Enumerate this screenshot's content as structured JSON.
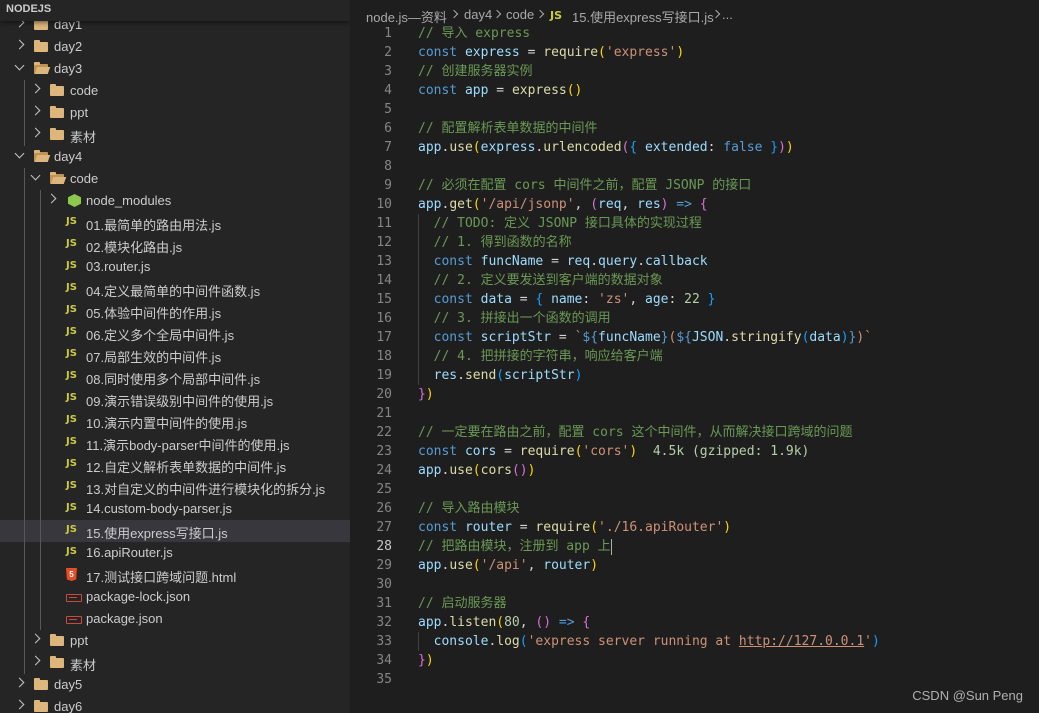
{
  "explorer": {
    "title": "NODEJS",
    "items": [
      {
        "label": "day1",
        "type": "folder",
        "depth": 0,
        "open": false
      },
      {
        "label": "day2",
        "type": "folder",
        "depth": 0,
        "open": false
      },
      {
        "label": "day3",
        "type": "folder",
        "depth": 0,
        "open": true
      },
      {
        "label": "code",
        "type": "folder",
        "depth": 1,
        "open": false
      },
      {
        "label": "ppt",
        "type": "folder",
        "depth": 1,
        "open": false
      },
      {
        "label": "素材",
        "type": "folder",
        "depth": 1,
        "open": false
      },
      {
        "label": "day4",
        "type": "folder",
        "depth": 0,
        "open": true
      },
      {
        "label": "code",
        "type": "folder",
        "depth": 1,
        "open": true
      },
      {
        "label": "node_modules",
        "type": "node",
        "depth": 2,
        "open": false
      },
      {
        "label": "01.最简单的路由用法.js",
        "type": "js",
        "depth": 2
      },
      {
        "label": "02.模块化路由.js",
        "type": "js",
        "depth": 2
      },
      {
        "label": "03.router.js",
        "type": "js",
        "depth": 2
      },
      {
        "label": "04.定义最简单的中间件函数.js",
        "type": "js",
        "depth": 2
      },
      {
        "label": "05.体验中间件的作用.js",
        "type": "js",
        "depth": 2
      },
      {
        "label": "06.定义多个全局中间件.js",
        "type": "js",
        "depth": 2
      },
      {
        "label": "07.局部生效的中间件.js",
        "type": "js",
        "depth": 2
      },
      {
        "label": "08.同时使用多个局部中间件.js",
        "type": "js",
        "depth": 2
      },
      {
        "label": "09.演示错误级别中间件的使用.js",
        "type": "js",
        "depth": 2
      },
      {
        "label": "10.演示内置中间件的使用.js",
        "type": "js",
        "depth": 2
      },
      {
        "label": "11.演示body-parser中间件的使用.js",
        "type": "js",
        "depth": 2
      },
      {
        "label": "12.自定义解析表单数据的中间件.js",
        "type": "js",
        "depth": 2
      },
      {
        "label": "13.对自定义的中间件进行模块化的拆分.js",
        "type": "js",
        "depth": 2
      },
      {
        "label": "14.custom-body-parser.js",
        "type": "js",
        "depth": 2
      },
      {
        "label": "15.使用express写接口.js",
        "type": "js",
        "depth": 2,
        "selected": true
      },
      {
        "label": "16.apiRouter.js",
        "type": "js",
        "depth": 2
      },
      {
        "label": "17.测试接口跨域问题.html",
        "type": "html",
        "depth": 2
      },
      {
        "label": "package-lock.json",
        "type": "json",
        "depth": 2
      },
      {
        "label": "package.json",
        "type": "json",
        "depth": 2
      },
      {
        "label": "ppt",
        "type": "folder",
        "depth": 1,
        "open": false
      },
      {
        "label": "素材",
        "type": "folder",
        "depth": 1,
        "open": false
      },
      {
        "label": "day5",
        "type": "folder",
        "depth": 0,
        "open": false
      },
      {
        "label": "day6",
        "type": "folder",
        "depth": 0,
        "open": false
      }
    ]
  },
  "breadcrumb": {
    "parts": [
      "node.js—资料",
      "day4",
      "code"
    ],
    "file_badge": "JS",
    "file": "15.使用express写接口.js",
    "more": "..."
  },
  "editor": {
    "current_line": 28,
    "lines": [
      {
        "n": 1,
        "t": [
          [
            "// 导入 express",
            "cm"
          ]
        ]
      },
      {
        "n": 2,
        "t": [
          [
            "const ",
            "kw"
          ],
          [
            "express",
            "var"
          ],
          [
            " = ",
            ""
          ],
          [
            "require",
            "fn"
          ],
          [
            "(",
            "b1"
          ],
          [
            "'express'",
            "str"
          ],
          [
            ")",
            "b1"
          ]
        ]
      },
      {
        "n": 3,
        "t": [
          [
            "// 创建服务器实例",
            "cm"
          ]
        ]
      },
      {
        "n": 4,
        "t": [
          [
            "const ",
            "kw"
          ],
          [
            "app",
            "var"
          ],
          [
            " = ",
            ""
          ],
          [
            "express",
            "fn"
          ],
          [
            "()",
            "b1"
          ]
        ]
      },
      {
        "n": 5,
        "t": []
      },
      {
        "n": 6,
        "t": [
          [
            "// 配置解析表单数据的中间件",
            "cm"
          ]
        ]
      },
      {
        "n": 7,
        "t": [
          [
            "app",
            "var"
          ],
          [
            ".",
            ""
          ],
          [
            "use",
            "fn"
          ],
          [
            "(",
            "b1"
          ],
          [
            "express",
            "var"
          ],
          [
            ".",
            ""
          ],
          [
            "urlencoded",
            "fn"
          ],
          [
            "(",
            "b2"
          ],
          [
            "{ ",
            "b3"
          ],
          [
            "extended",
            "var"
          ],
          [
            ": ",
            ""
          ],
          [
            "false",
            "kw"
          ],
          [
            " }",
            "b3"
          ],
          [
            ")",
            "b2"
          ],
          [
            ")",
            "b1"
          ]
        ]
      },
      {
        "n": 8,
        "t": []
      },
      {
        "n": 9,
        "t": [
          [
            "// 必须在配置 cors 中间件之前，配置 JSONP 的接口",
            "cm"
          ]
        ]
      },
      {
        "n": 10,
        "t": [
          [
            "app",
            "var"
          ],
          [
            ".",
            ""
          ],
          [
            "get",
            "fn"
          ],
          [
            "(",
            "b1"
          ],
          [
            "'/api/jsonp'",
            "str"
          ],
          [
            ", ",
            ""
          ],
          [
            "(",
            "b2"
          ],
          [
            "req",
            "var"
          ],
          [
            ", ",
            ""
          ],
          [
            "res",
            "var"
          ],
          [
            ")",
            "b2"
          ],
          [
            " => ",
            "kw"
          ],
          [
            "{",
            "b2"
          ]
        ]
      },
      {
        "n": 11,
        "t": [
          [
            "  // TODO: 定义 JSONP 接口具体的实现过程",
            "cm"
          ]
        ]
      },
      {
        "n": 12,
        "t": [
          [
            "  // 1. 得到函数的名称",
            "cm"
          ]
        ]
      },
      {
        "n": 13,
        "t": [
          [
            "  const ",
            "kw"
          ],
          [
            "funcName",
            "var"
          ],
          [
            " = ",
            ""
          ],
          [
            "req",
            "var"
          ],
          [
            ".",
            ""
          ],
          [
            "query",
            "var"
          ],
          [
            ".",
            ""
          ],
          [
            "callback",
            "var"
          ]
        ]
      },
      {
        "n": 14,
        "t": [
          [
            "  // 2. 定义要发送到客户端的数据对象",
            "cm"
          ]
        ]
      },
      {
        "n": 15,
        "t": [
          [
            "  const ",
            "kw"
          ],
          [
            "data",
            "var"
          ],
          [
            " = ",
            ""
          ],
          [
            "{ ",
            "b3"
          ],
          [
            "name",
            "var"
          ],
          [
            ": ",
            ""
          ],
          [
            "'zs'",
            "str"
          ],
          [
            ", ",
            ""
          ],
          [
            "age",
            "var"
          ],
          [
            ": ",
            ""
          ],
          [
            "22",
            "num"
          ],
          [
            " }",
            "b3"
          ]
        ]
      },
      {
        "n": 16,
        "t": [
          [
            "  // 3. 拼接出一个函数的调用",
            "cm"
          ]
        ]
      },
      {
        "n": 17,
        "t": [
          [
            "  const ",
            "kw"
          ],
          [
            "scriptStr",
            "var"
          ],
          [
            " = ",
            ""
          ],
          [
            "`",
            "str"
          ],
          [
            "${",
            "tpl"
          ],
          [
            "funcName",
            "var"
          ],
          [
            "}",
            "tpl"
          ],
          [
            "(",
            "str"
          ],
          [
            "${",
            "tpl"
          ],
          [
            "JSON",
            "var"
          ],
          [
            ".",
            ""
          ],
          [
            "stringify",
            "fn"
          ],
          [
            "(",
            "b3"
          ],
          [
            "data",
            "var"
          ],
          [
            ")",
            "b3"
          ],
          [
            "}",
            "tpl"
          ],
          [
            ")`",
            "str"
          ]
        ]
      },
      {
        "n": 18,
        "t": [
          [
            "  // 4. 把拼接的字符串，响应给客户端",
            "cm"
          ]
        ]
      },
      {
        "n": 19,
        "t": [
          [
            "  res",
            "var"
          ],
          [
            ".",
            ""
          ],
          [
            "send",
            "fn"
          ],
          [
            "(",
            "b3"
          ],
          [
            "scriptStr",
            "var"
          ],
          [
            ")",
            "b3"
          ]
        ]
      },
      {
        "n": 20,
        "t": [
          [
            "}",
            "b2"
          ],
          [
            ")",
            "b1"
          ]
        ]
      },
      {
        "n": 21,
        "t": []
      },
      {
        "n": 22,
        "t": [
          [
            "// 一定要在路由之前，配置 cors 这个中间件，从而解决接口跨域的问题",
            "cm"
          ]
        ]
      },
      {
        "n": 23,
        "t": [
          [
            "const ",
            "kw"
          ],
          [
            "cors",
            "var"
          ],
          [
            " = ",
            ""
          ],
          [
            "require",
            "fn"
          ],
          [
            "(",
            "b1"
          ],
          [
            "'cors'",
            "str"
          ],
          [
            ")",
            "b1"
          ],
          [
            "  4.5k (gzipped: 1.9k)",
            "hint"
          ]
        ]
      },
      {
        "n": 24,
        "t": [
          [
            "app",
            "var"
          ],
          [
            ".",
            ""
          ],
          [
            "use",
            "fn"
          ],
          [
            "(",
            "b1"
          ],
          [
            "cors",
            "fn"
          ],
          [
            "()",
            "b2"
          ],
          [
            ")",
            "b1"
          ]
        ]
      },
      {
        "n": 25,
        "t": []
      },
      {
        "n": 26,
        "t": [
          [
            "// 导入路由模块",
            "cm"
          ]
        ]
      },
      {
        "n": 27,
        "t": [
          [
            "const ",
            "kw"
          ],
          [
            "router",
            "var"
          ],
          [
            " = ",
            ""
          ],
          [
            "require",
            "fn"
          ],
          [
            "(",
            "b1"
          ],
          [
            "'./16.apiRouter'",
            "str"
          ],
          [
            ")",
            "b1"
          ]
        ]
      },
      {
        "n": 28,
        "t": [
          [
            "// 把路由模块，注册到 app 上",
            "cm"
          ]
        ]
      },
      {
        "n": 29,
        "t": [
          [
            "app",
            "var"
          ],
          [
            ".",
            ""
          ],
          [
            "use",
            "fn"
          ],
          [
            "(",
            "b1"
          ],
          [
            "'/api'",
            "str"
          ],
          [
            ", ",
            ""
          ],
          [
            "router",
            "var"
          ],
          [
            ")",
            "b1"
          ]
        ]
      },
      {
        "n": 30,
        "t": []
      },
      {
        "n": 31,
        "t": [
          [
            "// 启动服务器",
            "cm"
          ]
        ]
      },
      {
        "n": 32,
        "t": [
          [
            "app",
            "var"
          ],
          [
            ".",
            ""
          ],
          [
            "listen",
            "fn"
          ],
          [
            "(",
            "b1"
          ],
          [
            "80",
            "num"
          ],
          [
            ", ",
            ""
          ],
          [
            "()",
            "b2"
          ],
          [
            " => ",
            "kw"
          ],
          [
            "{",
            "b2"
          ]
        ]
      },
      {
        "n": 33,
        "t": [
          [
            "  console",
            "var"
          ],
          [
            ".",
            ""
          ],
          [
            "log",
            "fn"
          ],
          [
            "(",
            "b3"
          ],
          [
            "'express server running at ",
            "str"
          ],
          [
            "http://127.0.0.1",
            "lnk"
          ],
          [
            "'",
            "str"
          ],
          [
            ")",
            "b3"
          ]
        ]
      },
      {
        "n": 34,
        "t": [
          [
            "}",
            "b2"
          ],
          [
            ")",
            "b1"
          ]
        ]
      },
      {
        "n": 35,
        "t": []
      }
    ]
  },
  "watermark": "CSDN @Sun  Peng",
  "colors": {
    "sidebar_bg": "#252526",
    "editor_bg": "#1e1e1e",
    "selection": "#37373d",
    "comment": "#6a9955",
    "keyword": "#569cd6",
    "variable": "#9cdcfe",
    "function": "#dcdcaa",
    "string": "#ce9178",
    "number": "#b5cea8"
  },
  "icons": {
    "folder": "folder-icon",
    "js": "js-file-icon",
    "html": "html5-file-icon",
    "json": "json-file-icon",
    "node_modules": "node-modules-icon",
    "chevron": "chevron-icon"
  }
}
